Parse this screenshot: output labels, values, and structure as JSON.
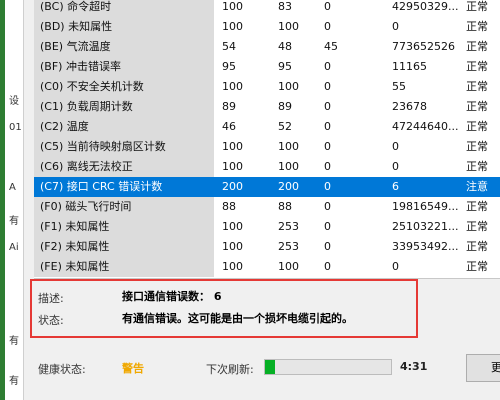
{
  "left_strip": {
    "glyphs": [
      "设",
      "01",
      "A",
      "有",
      "Ai",
      "有",
      "有"
    ]
  },
  "smart_table": {
    "rows": [
      {
        "name": "(BC) 命令超时",
        "current": "100",
        "worst": "83",
        "threshold": "0",
        "raw": "42950329...",
        "status": "正常"
      },
      {
        "name": "(BD) 未知属性",
        "current": "100",
        "worst": "100",
        "threshold": "0",
        "raw": "0",
        "status": "正常"
      },
      {
        "name": "(BE) 气流温度",
        "current": "54",
        "worst": "48",
        "threshold": "45",
        "raw": "773652526",
        "status": "正常"
      },
      {
        "name": "(BF) 冲击错误率",
        "current": "95",
        "worst": "95",
        "threshold": "0",
        "raw": "11165",
        "status": "正常"
      },
      {
        "name": "(C0) 不安全关机计数",
        "current": "100",
        "worst": "100",
        "threshold": "0",
        "raw": "55",
        "status": "正常"
      },
      {
        "name": "(C1) 负载周期计数",
        "current": "89",
        "worst": "89",
        "threshold": "0",
        "raw": "23678",
        "status": "正常"
      },
      {
        "name": "(C2) 温度",
        "current": "46",
        "worst": "52",
        "threshold": "0",
        "raw": "47244640...",
        "status": "正常"
      },
      {
        "name": "(C5) 当前待映射扇区计数",
        "current": "100",
        "worst": "100",
        "threshold": "0",
        "raw": "0",
        "status": "正常"
      },
      {
        "name": "(C6) 离线无法校正",
        "current": "100",
        "worst": "100",
        "threshold": "0",
        "raw": "0",
        "status": "正常"
      },
      {
        "name": "(C7) 接口 CRC 错误计数",
        "current": "200",
        "worst": "200",
        "threshold": "0",
        "raw": "6",
        "status": "注意",
        "selected": true
      },
      {
        "name": "(F0) 磁头飞行时间",
        "current": "88",
        "worst": "88",
        "threshold": "0",
        "raw": "19816549...",
        "status": "正常"
      },
      {
        "name": "(F1) 未知属性",
        "current": "100",
        "worst": "253",
        "threshold": "0",
        "raw": "25103221...",
        "status": "正常"
      },
      {
        "name": "(F2) 未知属性",
        "current": "100",
        "worst": "253",
        "threshold": "0",
        "raw": "33953492...",
        "status": "正常"
      },
      {
        "name": "(FE) 未知属性",
        "current": "100",
        "worst": "100",
        "threshold": "0",
        "raw": "0",
        "status": "正常"
      }
    ]
  },
  "details": {
    "description_label": "描述:",
    "description_value": "接口通信错误数： 6",
    "status_label": "状态:",
    "status_value": "有通信错误。这可能是由一个损坏电缆引起的。"
  },
  "status_bar": {
    "health_label": "健康状态:",
    "health_value": "警告",
    "refresh_label": "下次刷新:",
    "refresh_progress": 0.08,
    "refresh_time": "4:31",
    "refresh_button_label": "更"
  },
  "colors": {
    "selection": "#0078d7",
    "warning": "#f0a800",
    "highlight_border": "#e53935",
    "progress_fill": "#06b025"
  }
}
